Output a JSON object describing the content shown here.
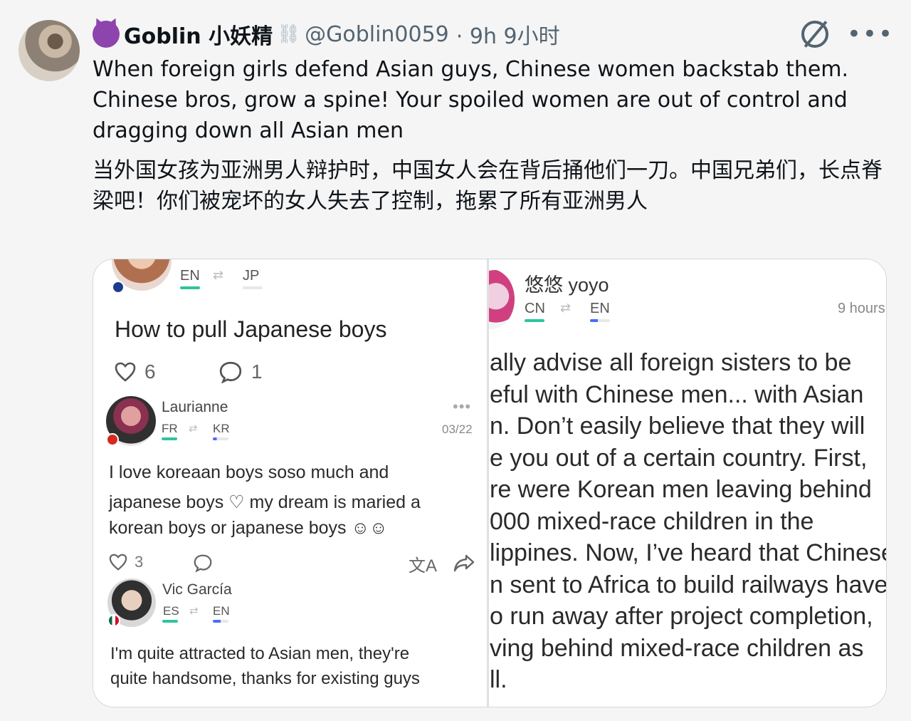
{
  "tweet": {
    "author_name": "Goblin 小妖精",
    "handle": "@Goblin0059",
    "time": "· 9h 9小时",
    "text_en": "When foreign girls defend Asian guys, Chinese women backstab them. Chinese bros, grow a spine! Your spoiled women are out of control and dragging down all Asian men",
    "text_zh": "当外国女孩为亚洲男人辩护时，中国女人会在背后捅他们一刀。中国兄弟们，长点脊梁吧！你们被宠坏的女人失去了控制，拖累了所有亚洲男人"
  },
  "left_panel": {
    "poster_lang_from": "EN",
    "poster_lang_to": "JP",
    "post_title": "How to pull Japanese boys",
    "likes": "6",
    "comments": "1",
    "comment1": {
      "name": "Laurianne",
      "lang_from": "FR",
      "lang_to": "KR",
      "date": "03/22",
      "text_line1": "I love koreaan boys soso much and",
      "text_line2": "japanese boys ♡ my dream is maried a",
      "text_line3": "korean boys or japanese boys ☺☺",
      "likes": "3"
    },
    "comment2": {
      "name": "Vic García",
      "lang_from": "ES",
      "lang_to": "EN",
      "text_line1": "I'm quite attracted to Asian men, they're",
      "text_line2": "quite handsome, thanks for existing guys"
    }
  },
  "right_panel": {
    "name": "悠悠 yoyo",
    "lang_from": "CN",
    "lang_to": "EN",
    "time": "9 hours",
    "lines": [
      "ally advise all foreign sisters to be",
      "eful with Chinese men... with Asian",
      "n. Don’t easily believe that they will",
      "e you out of a certain country. First,",
      "re were Korean men leaving behind",
      "000 mixed-race children in the",
      "lippines. Now, I’ve heard that Chinese",
      "n sent to Africa to build railways have",
      "o run away after project completion,",
      "ving behind mixed-race children as",
      "ll."
    ]
  },
  "icons": [
    "grok-icon",
    "more-icon",
    "heart-icon",
    "comment-icon",
    "translate-icon",
    "share-icon",
    "swap-icon"
  ],
  "colors": {
    "accent_green": "#2ec4a0",
    "accent_blue": "#4a6cf7",
    "text": "#0f1419",
    "muted": "#536471"
  }
}
